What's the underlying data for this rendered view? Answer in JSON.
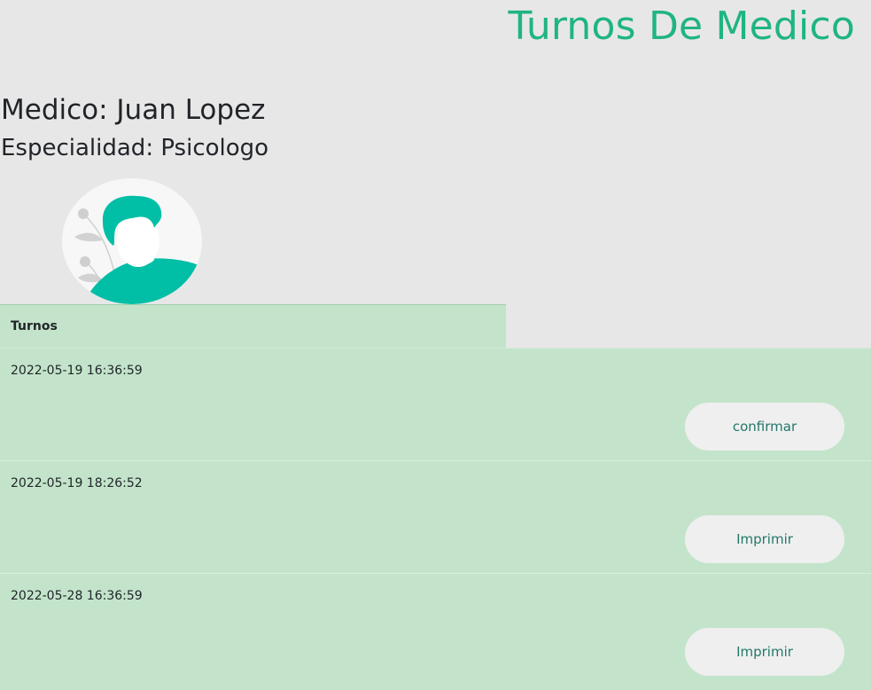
{
  "header": {
    "title": "Turnos De Medico"
  },
  "doctor": {
    "name_line": "Medico: Juan Lopez",
    "specialty_line": "Especialidad: Psicologo",
    "avatar_icon": "person-avatar-icon"
  },
  "table": {
    "header_label": "Turnos",
    "rows": [
      {
        "datetime": "2022-05-19 16:36:59",
        "action": "confirmar"
      },
      {
        "datetime": "2022-05-19 18:26:52",
        "action": "Imprimir"
      },
      {
        "datetime": "2022-05-28 16:36:59",
        "action": "Imprimir"
      }
    ]
  },
  "colors": {
    "accent": "#1fb580",
    "table_bg": "#c3e4cb",
    "page_bg": "#e8e7e8",
    "button_bg": "#efefef",
    "button_text": "#23776a",
    "avatar_shirt": "#00bfa6"
  }
}
